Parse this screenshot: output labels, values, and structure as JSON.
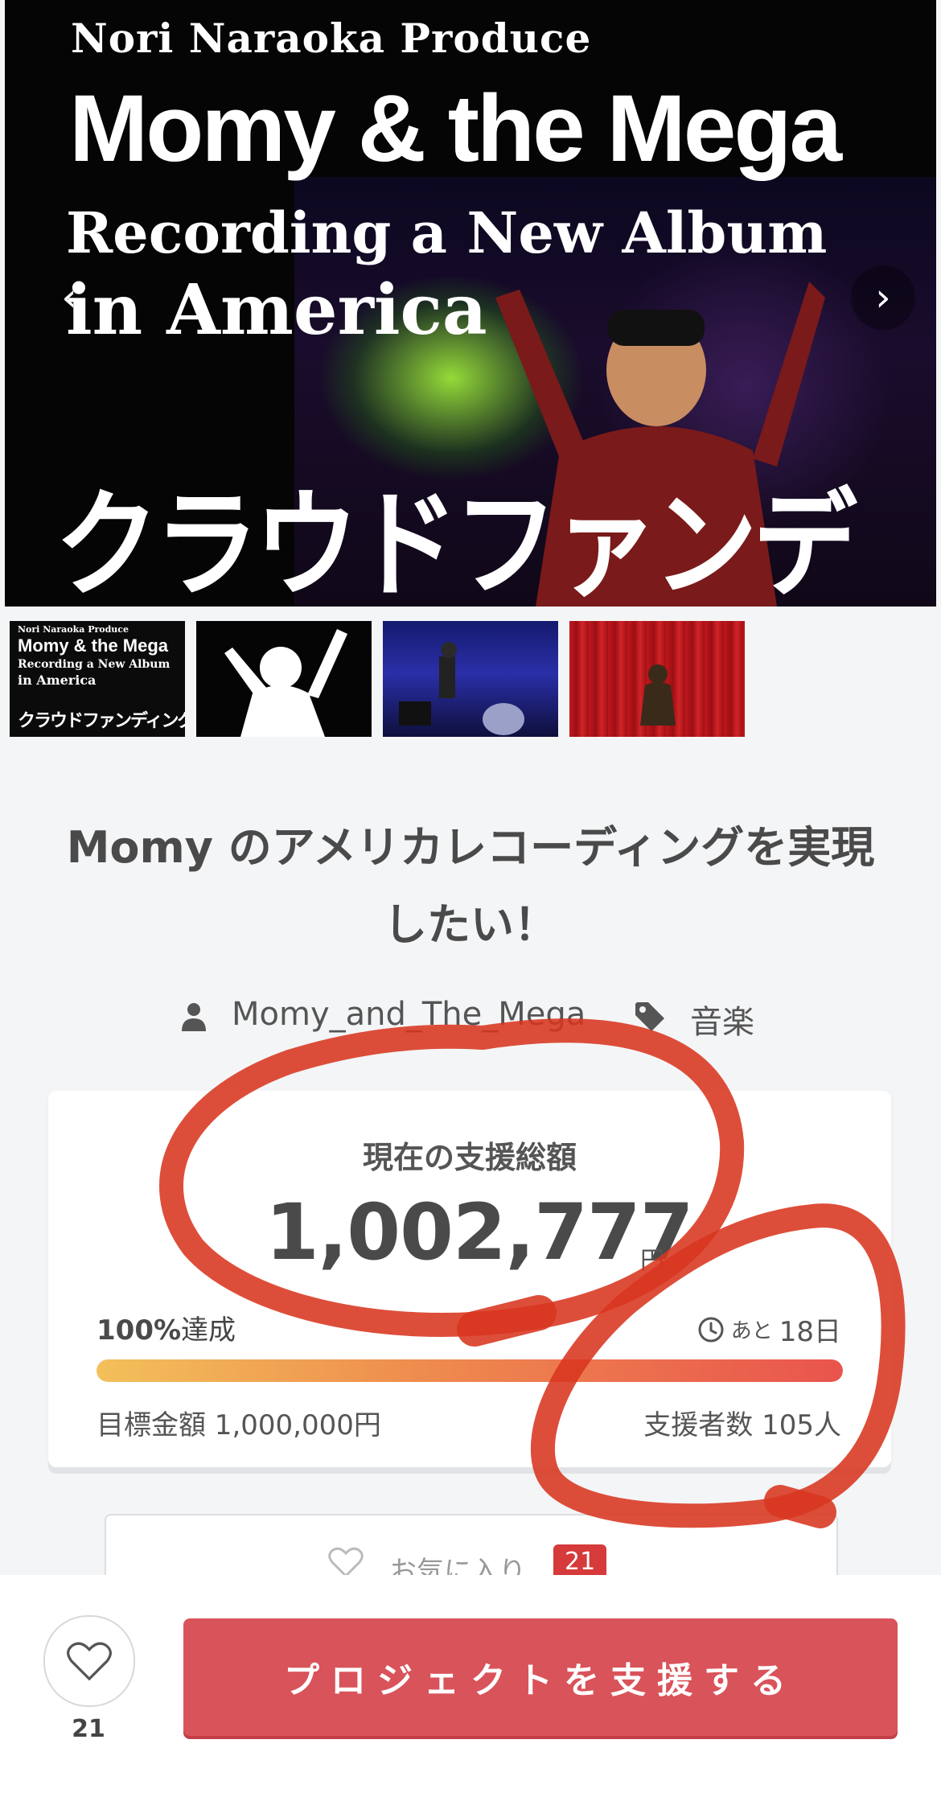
{
  "hero": {
    "line1": "Nori Naraoka Produce",
    "line2": "Momy & the Mega",
    "line3": "Recording a New Album",
    "line4": "in America",
    "jp": "クラウドファンディング",
    "prev_icon": "chevron-left-icon",
    "next_icon": "chevron-right-icon"
  },
  "thumbnails": {
    "t1": [
      "Nori Naraoka Produce",
      "Momy & the Mega",
      "Recording a New Album",
      "in America",
      "クラウドファンディング"
    ]
  },
  "project": {
    "title": "Momy のアメリカレコーディングを実現したい！",
    "owner": "Momy_and_The_Mega",
    "category": "音楽"
  },
  "funding": {
    "label": "現在の支援総額",
    "amount": "1,002,777",
    "currency": "円",
    "percent_value": "100%",
    "percent_suffix": "達成",
    "remaining_prefix": "あと",
    "remaining_days": "18日",
    "goal": "目標金額 1,000,000円",
    "backers": "支援者数 105人",
    "progress_fraction": 1.0
  },
  "favorite": {
    "label": "お気に入り",
    "count": "21"
  },
  "bottom_bar": {
    "like_count": "21",
    "support_button": "プロジェクトを支援する"
  },
  "colors": {
    "accent_red": "#d9535a",
    "annotation_red": "#d8361f",
    "progress_start": "#f3c05a",
    "progress_end": "#e9544d"
  }
}
